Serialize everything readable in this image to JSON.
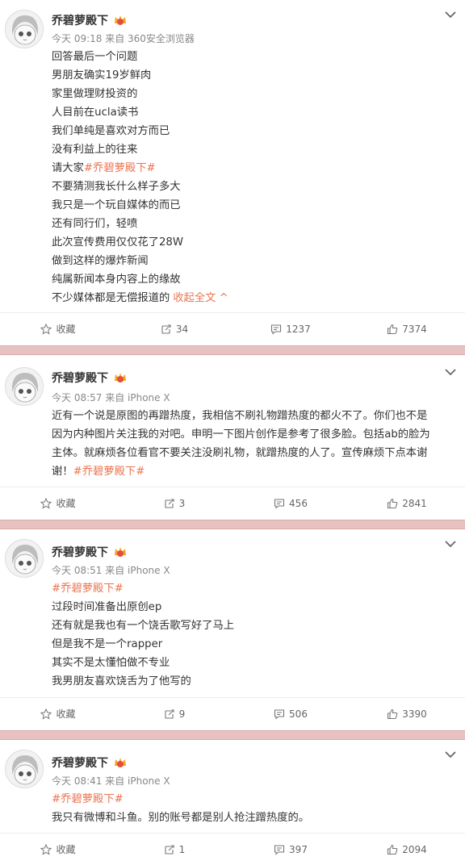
{
  "posts": [
    {
      "author": "乔碧萝殿下",
      "meta": "今天 09:18 来自 360安全浏览器",
      "lines": [
        "回答最后一个问题",
        "男朋友确实19岁鲜肉",
        "家里做理财投资的",
        "人目前在ucla读书",
        "我们单纯是喜欢对方而已",
        "没有利益上的往来",
        "请大家",
        "不要猜测我长什么样子多大",
        "我只是一个玩自媒体的而已",
        "还有同行们，轻喷",
        "此次宣传费用仅仅花了28W",
        "做到这样的爆炸新闻",
        "纯属新闻本身内容上的缘故",
        "不少媒体都是无偿报道的"
      ],
      "tag": "#乔碧萝殿下#",
      "collapse_label": "收起全文 ^",
      "fav_label": "收藏",
      "repost": "34",
      "comment": "1237",
      "like": "7374"
    },
    {
      "author": "乔碧萝殿下",
      "meta": "今天 08:57 来自 iPhone X",
      "lines": [
        "近有一个说是原图的再蹭热度，我相信不刷礼物蹭热度的都火不了。你们也不是",
        "因为内种图片关注我的对吧。申明一下图片创作是参考了很多脸。包括ab的脸为",
        "主体。就麻烦各位看官不要关注没刷礼物，就蹭热度的人了。宣传麻烦下点本谢",
        "谢！"
      ],
      "tag": "#乔碧萝殿下#",
      "fav_label": "收藏",
      "repost": "3",
      "comment": "456",
      "like": "2841"
    },
    {
      "author": "乔碧萝殿下",
      "meta": "今天 08:51 来自 iPhone X",
      "tag": "#乔碧萝殿下#",
      "lines": [
        "过段时间准备出原创ep",
        "还有就是我也有一个饶舌歌写好了马上",
        "但是我不是一个rapper",
        "其实不是太懂怕做不专业",
        "我男朋友喜欢饶舌为了他写的"
      ],
      "fav_label": "收藏",
      "repost": "9",
      "comment": "506",
      "like": "3390"
    },
    {
      "author": "乔碧萝殿下",
      "meta": "今天 08:41 来自 iPhone X",
      "tag": "#乔碧萝殿下#",
      "lines": [
        "我只有微博和斗鱼。别的账号都是别人抢注蹭热度的。"
      ],
      "fav_label": "收藏",
      "repost": "1",
      "comment": "397",
      "like": "2094"
    }
  ],
  "colors": {
    "accent": "#eb7350",
    "separator": "#e8c2c0",
    "muted": "#888888"
  }
}
